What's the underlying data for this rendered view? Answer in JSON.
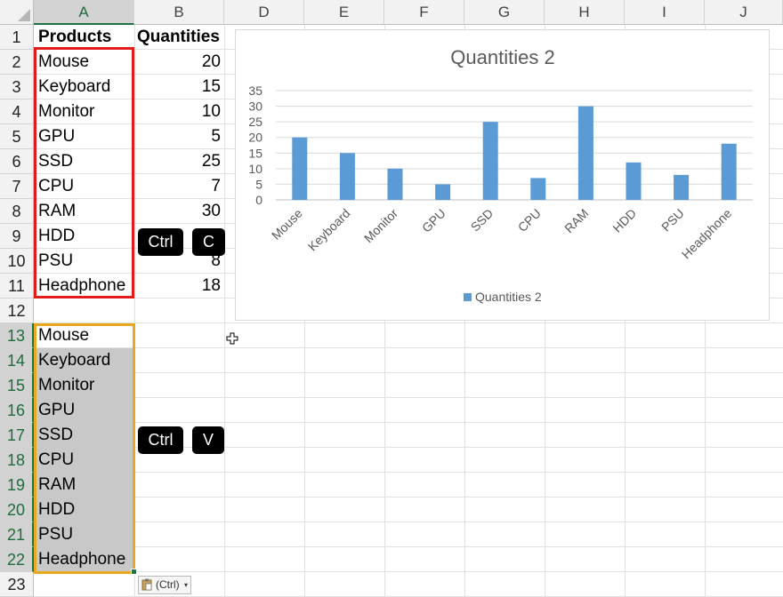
{
  "sheet": {
    "columns": [
      "A",
      "B",
      "D",
      "E",
      "F",
      "G",
      "H",
      "I",
      "J"
    ],
    "rows": [
      "1",
      "2",
      "3",
      "4",
      "5",
      "6",
      "7",
      "8",
      "9",
      "10",
      "11",
      "12",
      "13",
      "14",
      "15",
      "16",
      "17",
      "18",
      "19",
      "20",
      "21",
      "22",
      "23"
    ],
    "header_row": {
      "a": "Products",
      "b": "Quantities"
    },
    "data_rows": [
      {
        "product": "Mouse",
        "quantity": "20"
      },
      {
        "product": "Keyboard",
        "quantity": "15"
      },
      {
        "product": "Monitor",
        "quantity": "10"
      },
      {
        "product": "GPU",
        "quantity": "5"
      },
      {
        "product": "SSD",
        "quantity": "25"
      },
      {
        "product": "CPU",
        "quantity": "7"
      },
      {
        "product": "RAM",
        "quantity": "30"
      },
      {
        "product": "HDD",
        "quantity": ""
      },
      {
        "product": "PSU",
        "quantity": "8"
      },
      {
        "product": "Headphone",
        "quantity": "18"
      }
    ],
    "pasted_rows": [
      "Mouse",
      "Keyboard",
      "Monitor",
      "GPU",
      "SSD",
      "CPU",
      "RAM",
      "HDD",
      "PSU",
      "Headphone"
    ]
  },
  "shortcuts": {
    "copy": {
      "modifier": "Ctrl",
      "key": "C"
    },
    "paste": {
      "modifier": "Ctrl",
      "key": "V"
    }
  },
  "paste_options": {
    "label": "(Ctrl)",
    "arrow": "▾"
  },
  "colors": {
    "bar": "#5b9bd5",
    "copy_border": "#e21b1b",
    "paste_border": "#e7a81e",
    "selection_green": "#217346"
  },
  "chart_data": {
    "type": "bar",
    "title": "Quantities 2",
    "categories": [
      "Mouse",
      "Keyboard",
      "Monitor",
      "GPU",
      "SSD",
      "CPU",
      "RAM",
      "HDD",
      "PSU",
      "Headphone"
    ],
    "series": [
      {
        "name": "Quantities 2",
        "values": [
          20,
          15,
          10,
          5,
          25,
          7,
          30,
          12,
          8,
          18
        ]
      }
    ],
    "y_ticks": [
      "0",
      "5",
      "10",
      "15",
      "20",
      "25",
      "30",
      "35"
    ],
    "ylim": [
      0,
      35
    ],
    "grid": true,
    "legend": "bottom"
  }
}
